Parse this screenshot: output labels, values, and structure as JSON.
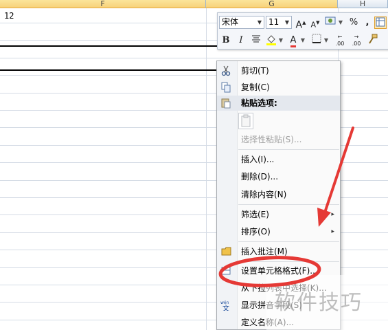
{
  "columns": {
    "f": "F",
    "g": "G",
    "h": "H"
  },
  "cell": {
    "value": "12"
  },
  "mini_toolbar": {
    "font_name": "宋体",
    "font_size": "11",
    "grow_font": "A",
    "shrink_font": "A",
    "percent": "%",
    "comma": ",",
    "bold": "B",
    "italic": "I",
    "font_color_letter": "A",
    "decimal_increase": ".00",
    "decimal_decrease": ".00"
  },
  "context_menu": {
    "items": [
      {
        "label": "剪切(T)",
        "icon": "scissors-icon"
      },
      {
        "label": "复制(C)",
        "icon": "copy-icon"
      },
      {
        "label": "粘贴选项:",
        "icon": "paste-icon"
      },
      {
        "label": "选择性粘贴(S)..."
      },
      {
        "label": "插入(I)..."
      },
      {
        "label": "删除(D)..."
      },
      {
        "label": "清除内容(N)"
      },
      {
        "label": "筛选(E)",
        "submenu": "▸"
      },
      {
        "label": "排序(O)",
        "submenu": "▸"
      },
      {
        "label": "插入批注(M)",
        "icon": "comment-icon"
      },
      {
        "label": "设置单元格格式(F)...",
        "icon": "format-cells-icon"
      },
      {
        "label": "从下拉列表中选择(K)..."
      },
      {
        "label": "显示拼音字段(S)",
        "icon": "phonetic-icon"
      },
      {
        "label": "定义名称(A)..."
      }
    ]
  },
  "annotation": {
    "watermark": "软件技巧",
    "highlight_color": "#e53935"
  }
}
